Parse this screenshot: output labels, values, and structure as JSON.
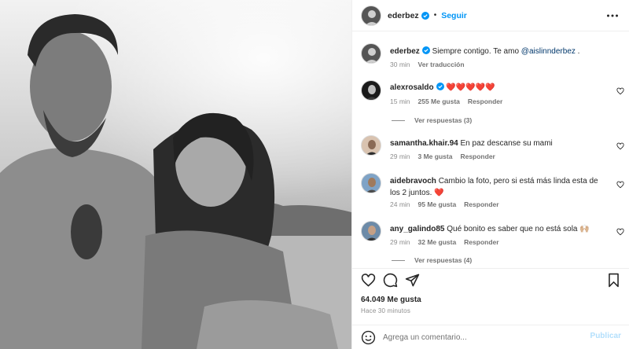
{
  "post": {
    "author": "ederbez",
    "follow_label": "Seguir",
    "dot": "•"
  },
  "caption": {
    "username": "ederbez",
    "text_before": "Siempre contigo. Te amo ",
    "mention": "@aislinnderbez",
    "text_after": " .",
    "time": "30 min",
    "translate": "Ver traducción"
  },
  "comments": [
    {
      "username": "alexrosaldo",
      "verified": true,
      "text": "❤️❤️❤️❤️❤️",
      "time": "15 min",
      "likes": "255 Me gusta",
      "reply": "Responder"
    },
    {
      "username": "samantha.khair.94",
      "verified": false,
      "text": "En paz descanse su mami",
      "time": "29 min",
      "likes": "3 Me gusta",
      "reply": "Responder"
    },
    {
      "username": "aidebravoch",
      "verified": false,
      "text": "Cambio la foto, pero si está más linda esta de los 2 juntos. ❤️",
      "time": "24 min",
      "likes": "95 Me gusta",
      "reply": "Responder"
    },
    {
      "username": "any_galindo85",
      "verified": false,
      "text": "Qué bonito es saber que no está sola 🙌🏼",
      "time": "29 min",
      "likes": "32 Me gusta",
      "reply": "Responder"
    }
  ],
  "view_replies": [
    "Ver respuestas (3)",
    "Ver respuestas (4)"
  ],
  "footer": {
    "likes": "64.049 Me gusta",
    "time_ago": "Hace 30 minutos",
    "comment_placeholder": "Agrega un comentario...",
    "publish": "Publicar"
  },
  "colors": {
    "accent": "#0095f6",
    "publish_disabled": "#b2dffc",
    "heart": "#ed4956"
  },
  "icons": [
    "verified-badge-icon",
    "more-options-icon",
    "like-heart-icon",
    "comment-icon",
    "share-icon",
    "save-bookmark-icon",
    "emoji-icon"
  ]
}
